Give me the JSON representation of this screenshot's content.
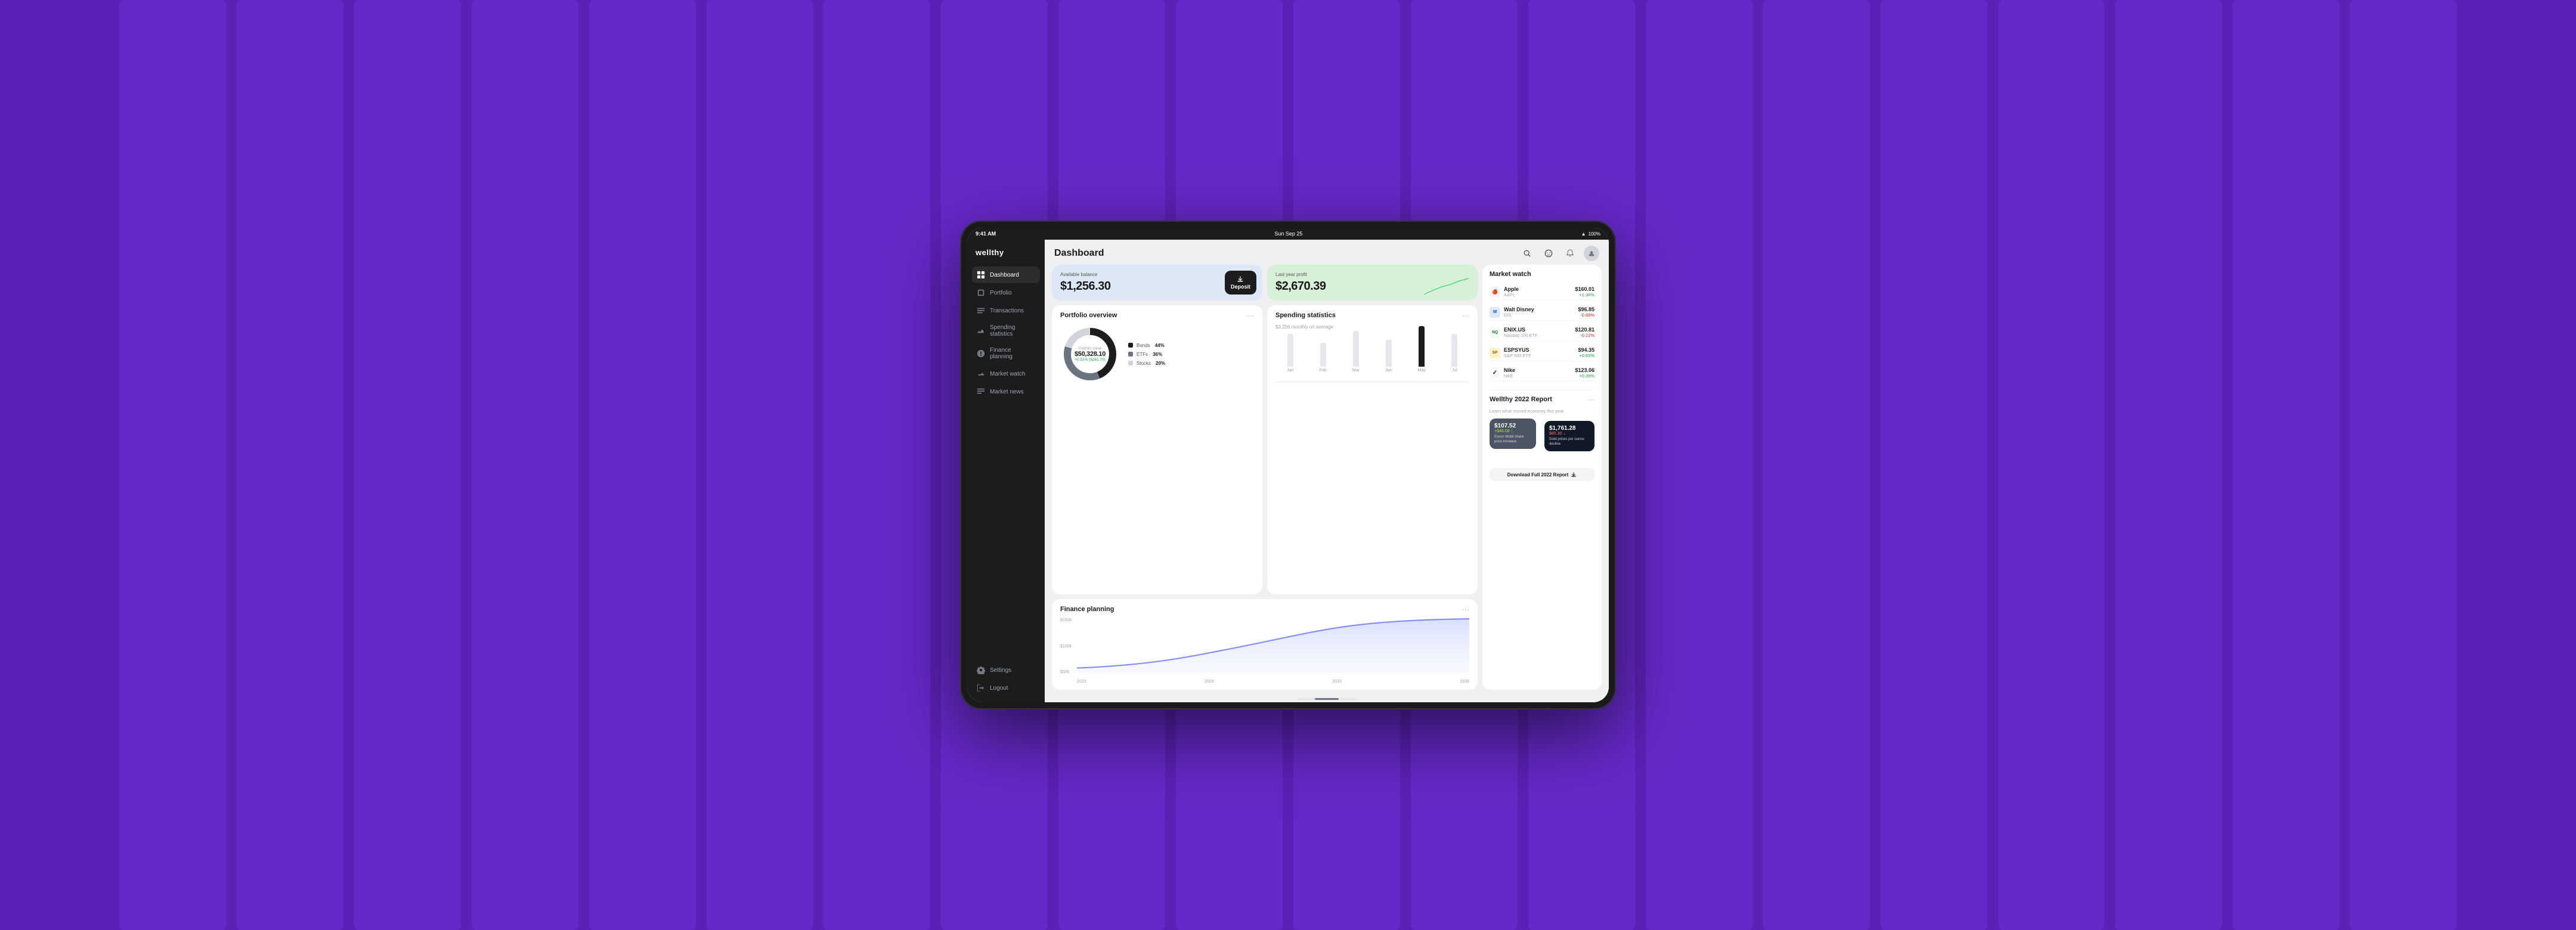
{
  "background": {
    "color": "#5b21b6"
  },
  "status_bar": {
    "time": "9:41 AM",
    "date": "Sun Sep 25",
    "battery": "100%",
    "wifi": true
  },
  "app": {
    "name": "wellthy"
  },
  "nav": {
    "items": [
      {
        "id": "dashboard",
        "label": "Dashboard",
        "active": true
      },
      {
        "id": "portfolio",
        "label": "Portfolio",
        "active": false
      },
      {
        "id": "transactions",
        "label": "Transactions",
        "active": false
      },
      {
        "id": "spending",
        "label": "Spending statistics",
        "active": false
      },
      {
        "id": "finance",
        "label": "Finance planning",
        "active": false
      },
      {
        "id": "market",
        "label": "Market watch",
        "active": false
      },
      {
        "id": "news",
        "label": "Market news",
        "active": false
      }
    ],
    "bottom": [
      {
        "id": "settings",
        "label": "Settings"
      },
      {
        "id": "logout",
        "label": "Logout"
      }
    ]
  },
  "page_title": "Dashboard",
  "balance_card": {
    "label": "Available balance",
    "amount": "$1,256.30",
    "deposit_btn": "Deposit"
  },
  "profit_card": {
    "label": "Last year profit",
    "amount": "$2,670.39"
  },
  "market_watch": {
    "title": "Market watch",
    "items": [
      {
        "name": "Apple",
        "sub": "AAPL",
        "icon_color": "#f3f4f6",
        "icon_text": "🍎",
        "price": "$160.01",
        "change": "+1.34%",
        "positive": true
      },
      {
        "name": "Walt Disney",
        "sub": "DIS",
        "icon_color": "#dbeafe",
        "icon_text": "W",
        "price": "$96.85",
        "change": "-0.88%",
        "positive": false
      },
      {
        "name": "ENIX.US",
        "sub": "Nasdaq 100 ETF",
        "icon_color": "#f0fdf4",
        "icon_text": "NQ",
        "price": "$120.81",
        "change": "-0.22%",
        "positive": false
      },
      {
        "name": "ESPSYUS",
        "sub": "S&P 500 ETF",
        "icon_color": "#fef3c7",
        "icon_text": "SP",
        "price": "$94.35",
        "change": "+0.65%",
        "positive": true
      },
      {
        "name": "Nike",
        "sub": "NKE",
        "icon_color": "#f9fafb",
        "icon_text": "✓",
        "price": "$123.06",
        "change": "+0.39%",
        "positive": true
      }
    ]
  },
  "portfolio_overview": {
    "title": "Portfolio overview",
    "value_label": "Portfolio Value",
    "value": "$50,328.10",
    "change": "+0.52% ($261.70)",
    "legend": [
      {
        "label": "Bonds",
        "pct": "44%",
        "color": "#1c1c1e"
      },
      {
        "label": "ETFs",
        "pct": "36%",
        "color": "#6b7280"
      },
      {
        "label": "Stocks",
        "pct": "20%",
        "color": "#d1d5db"
      }
    ]
  },
  "spending_stats": {
    "title": "Spending statistics",
    "avg": "$3,256 monthly on average",
    "bars": [
      {
        "label": "Jan",
        "height": 55,
        "active": false
      },
      {
        "label": "Feb",
        "height": 40,
        "active": false
      },
      {
        "label": "Mar",
        "height": 65,
        "active": false
      },
      {
        "label": "Apr",
        "height": 48,
        "active": false
      },
      {
        "label": "May",
        "height": 70,
        "active": true
      },
      {
        "label": "Jul",
        "height": 58,
        "active": false
      }
    ]
  },
  "finance_planning": {
    "title": "Finance planning",
    "y_labels": [
      "$150k",
      "$100k",
      "$50k"
    ],
    "x_labels": [
      "2023",
      "2028",
      "2033",
      "2038"
    ],
    "chart_area_color": "#c7d2fe"
  },
  "report": {
    "title": "Wellthy 2022 Report",
    "subtitle": "Learn what moved economy this year",
    "card1": {
      "value": "$107.52",
      "change": "+$46.08 ↑",
      "desc": "Exxon Mobil share price increase"
    },
    "card2": {
      "value": "$1,761.28",
      "change": "$80.30 ↓",
      "desc": "Gold prices per ounce decline"
    },
    "download_btn": "Download Full 2022 Report"
  }
}
